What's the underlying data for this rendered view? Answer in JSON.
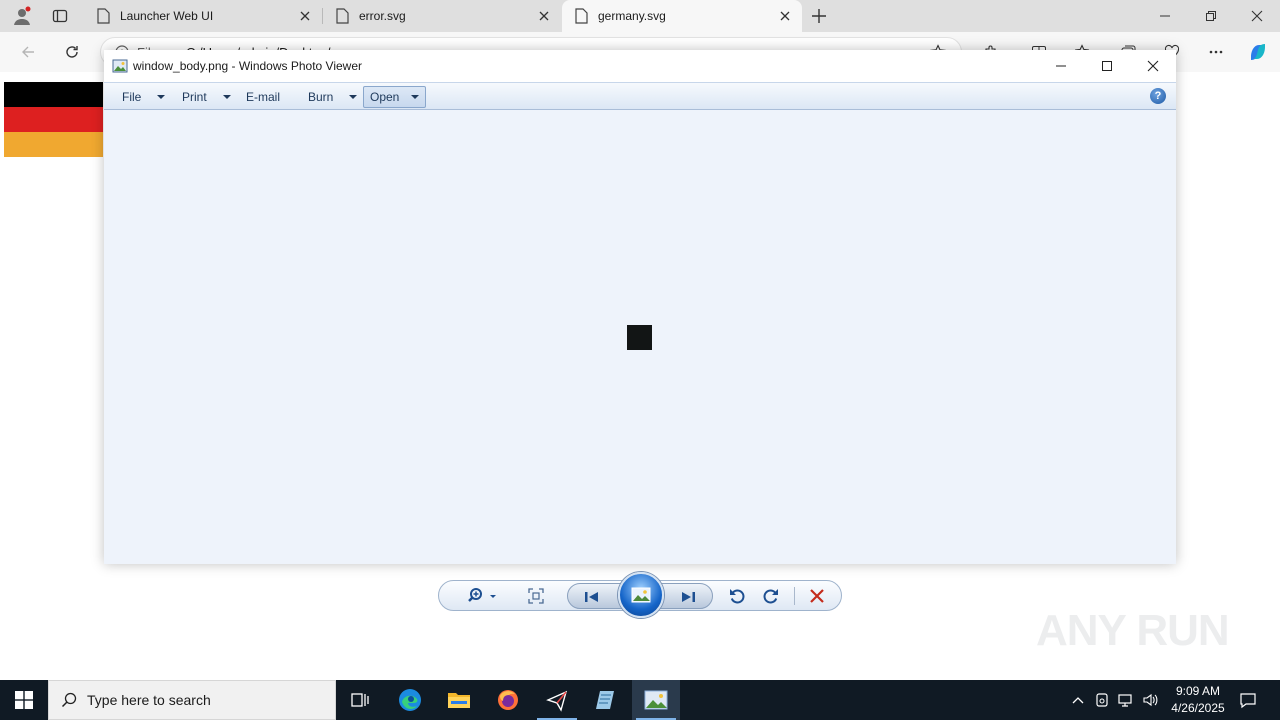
{
  "browser": {
    "tabs": [
      {
        "label": "Launcher Web UI",
        "active": false
      },
      {
        "label": "error.svg",
        "active": false
      },
      {
        "label": "germany.svg",
        "active": true
      }
    ],
    "address": {
      "site_chip": "File",
      "url": "C:/Users/admin/Desktop/germany.svg"
    }
  },
  "page": {
    "flag_colors": [
      "#000000",
      "#dd2020",
      "#f0a830"
    ]
  },
  "photo_viewer": {
    "title": "window_body.png - Windows Photo Viewer",
    "menu": {
      "file": "File",
      "print": "Print",
      "email": "E-mail",
      "burn": "Burn",
      "open": "Open"
    },
    "help": "?",
    "canvas_color": "#eef3fb",
    "image_color": "#121515"
  },
  "watermark": "ANY RUN",
  "taskbar": {
    "search_placeholder": "Type here to search",
    "time": "9:09 AM",
    "date": "4/26/2025"
  }
}
